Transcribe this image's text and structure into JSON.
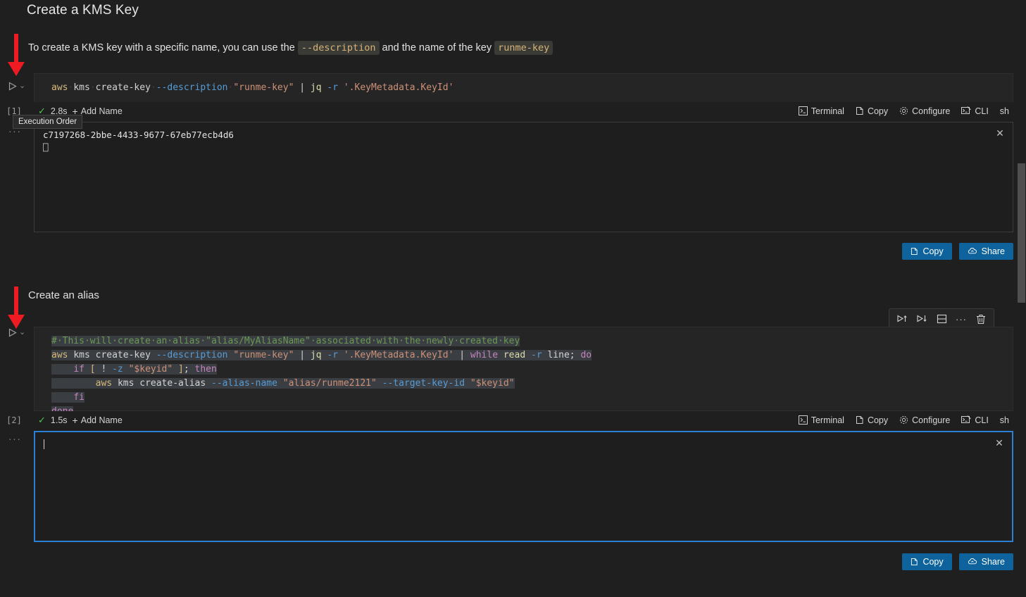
{
  "document": {
    "heading1": "Create a KMS Key",
    "paragraph": {
      "part1": "To create a KMS key with a specific name, you can use the ",
      "code1": "--description",
      "part2": " and the name of the key ",
      "code2": "runme-key"
    },
    "heading2": "Create an alias"
  },
  "tooltip": {
    "execution_order": "Execution Order"
  },
  "cell1": {
    "code_lines": [
      {
        "segments": [
          {
            "text": "aws",
            "cls": "t-cmd"
          },
          {
            "text": "·",
            "cls": "dot"
          },
          {
            "text": "kms",
            "cls": "t-arg"
          },
          {
            "text": "·",
            "cls": "dot"
          },
          {
            "text": "create-key",
            "cls": "t-arg"
          },
          {
            "text": "·",
            "cls": "dot"
          },
          {
            "text": "--description",
            "cls": "t-flag"
          },
          {
            "text": "·",
            "cls": "dot"
          },
          {
            "text": "\"runme-key\"",
            "cls": "t-str"
          },
          {
            "text": " | ",
            "cls": "t-pipe"
          },
          {
            "text": "jq",
            "cls": "t-jq"
          },
          {
            "text": " ",
            "cls": "t-arg"
          },
          {
            "text": "-r",
            "cls": "t-flag"
          },
          {
            "text": " ",
            "cls": "t-arg"
          },
          {
            "text": "'.KeyMetadata.KeyId'",
            "cls": "t-str"
          }
        ]
      }
    ],
    "status": {
      "index": "[1]",
      "check": "✓",
      "duration": "2.8s",
      "add_name": "Add Name",
      "terminal": "Terminal",
      "copy": "Copy",
      "configure": "Configure",
      "cli": "CLI",
      "language": "sh"
    },
    "output": {
      "line1": "c7197268-2bbe-4433-9677-67eb77ecb4d6",
      "line2": "⎕",
      "dots": "···"
    },
    "actions": {
      "copy": "Copy",
      "share": "Share"
    }
  },
  "cell2": {
    "hover_toolbar": [
      {
        "name": "run-above-icon"
      },
      {
        "name": "run-below-icon"
      },
      {
        "name": "split-cell-icon"
      },
      {
        "name": "more-actions-icon",
        "label": "···"
      },
      {
        "name": "delete-cell-icon"
      }
    ],
    "code_lines": [
      {
        "sel": true,
        "segments": [
          {
            "text": "#·This·will·create·an·alias·\"alias/MyAliasName\"·associated·with·the·newly·created·key",
            "cls": "t-cmt"
          }
        ]
      },
      {
        "sel": true,
        "segments": [
          {
            "text": "aws",
            "cls": "t-cmd"
          },
          {
            "text": "·",
            "cls": "dot"
          },
          {
            "text": "kms",
            "cls": "t-arg"
          },
          {
            "text": "·",
            "cls": "dot"
          },
          {
            "text": "create-key",
            "cls": "t-arg"
          },
          {
            "text": "·",
            "cls": "dot"
          },
          {
            "text": "--description",
            "cls": "t-flag"
          },
          {
            "text": "·",
            "cls": "dot"
          },
          {
            "text": "\"runme-key\"",
            "cls": "t-str"
          },
          {
            "text": "·",
            "cls": "dot"
          },
          {
            "text": "|",
            "cls": "t-pipe"
          },
          {
            "text": "·",
            "cls": "dot"
          },
          {
            "text": "jq",
            "cls": "t-jq"
          },
          {
            "text": "·",
            "cls": "dot"
          },
          {
            "text": "-r",
            "cls": "t-flag"
          },
          {
            "text": "·",
            "cls": "dot"
          },
          {
            "text": "'.KeyMetadata.KeyId'",
            "cls": "t-str"
          },
          {
            "text": "·",
            "cls": "dot"
          },
          {
            "text": "|",
            "cls": "t-pipe"
          },
          {
            "text": "·",
            "cls": "dot"
          },
          {
            "text": "while",
            "cls": "t-kw"
          },
          {
            "text": "·",
            "cls": "dot"
          },
          {
            "text": "read",
            "cls": "t-jq"
          },
          {
            "text": "·",
            "cls": "dot"
          },
          {
            "text": "-r",
            "cls": "t-flag"
          },
          {
            "text": "·",
            "cls": "dot"
          },
          {
            "text": "line;",
            "cls": "t-arg"
          },
          {
            "text": "·",
            "cls": "dot"
          },
          {
            "text": "do",
            "cls": "t-kw"
          }
        ]
      },
      {
        "sel": true,
        "segments": [
          {
            "text": "····",
            "cls": "dot"
          },
          {
            "text": "if",
            "cls": "t-kw"
          },
          {
            "text": "·",
            "cls": "dot"
          },
          {
            "text": "[",
            "cls": "t-brk"
          },
          {
            "text": "·",
            "cls": "dot"
          },
          {
            "text": "!",
            "cls": "t-arg"
          },
          {
            "text": "·",
            "cls": "dot"
          },
          {
            "text": "-z",
            "cls": "t-flag"
          },
          {
            "text": "·",
            "cls": "dot"
          },
          {
            "text": "\"$keyid\"",
            "cls": "t-str"
          },
          {
            "text": "·",
            "cls": "dot"
          },
          {
            "text": "]",
            "cls": "t-brk"
          },
          {
            "text": ";",
            "cls": "t-arg"
          },
          {
            "text": "·",
            "cls": "dot"
          },
          {
            "text": "then",
            "cls": "t-kw"
          }
        ]
      },
      {
        "sel": true,
        "segments": [
          {
            "text": "········",
            "cls": "dot"
          },
          {
            "text": "aws",
            "cls": "t-cmd"
          },
          {
            "text": "·",
            "cls": "dot"
          },
          {
            "text": "kms",
            "cls": "t-arg"
          },
          {
            "text": "·",
            "cls": "dot"
          },
          {
            "text": "create-alias",
            "cls": "t-arg"
          },
          {
            "text": "·",
            "cls": "dot"
          },
          {
            "text": "--alias-name",
            "cls": "t-flag"
          },
          {
            "text": "·",
            "cls": "dot"
          },
          {
            "text": "\"alias/runme2121\"",
            "cls": "t-str"
          },
          {
            "text": "·",
            "cls": "dot"
          },
          {
            "text": "--target-key-id",
            "cls": "t-flag"
          },
          {
            "text": "·",
            "cls": "dot"
          },
          {
            "text": "\"$keyid\"",
            "cls": "t-str"
          }
        ]
      },
      {
        "sel": true,
        "segments": [
          {
            "text": "····",
            "cls": "dot"
          },
          {
            "text": "fi",
            "cls": "t-kw"
          }
        ]
      },
      {
        "sel": true,
        "segments": [
          {
            "text": "done",
            "cls": "t-kw"
          }
        ]
      }
    ],
    "status": {
      "index": "[2]",
      "check": "✓",
      "duration": "1.5s",
      "add_name": "Add Name",
      "terminal": "Terminal",
      "copy": "Copy",
      "configure": "Configure",
      "cli": "CLI",
      "language": "sh"
    },
    "output": {
      "dots": "···"
    },
    "actions": {
      "copy": "Copy",
      "share": "Share"
    }
  },
  "colors": {
    "background": "#1f1f1f",
    "cell_background": "#252526",
    "output_background": "#1e1e1e",
    "accent_blue": "#0e639c",
    "focus_border": "#2b7fd4",
    "success_green": "#4ec94e",
    "annotation_red": "#ee1c22"
  }
}
